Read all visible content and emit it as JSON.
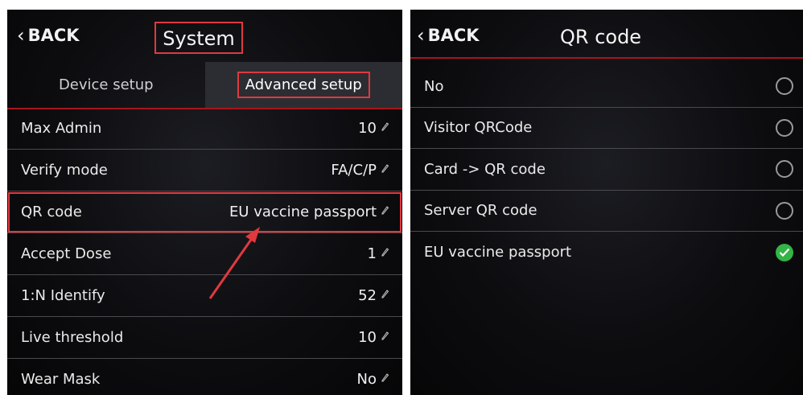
{
  "left": {
    "back_label": "BACK",
    "title": "System",
    "tabs": [
      {
        "label": "Device setup",
        "active": false
      },
      {
        "label": "Advanced setup",
        "active": true
      }
    ],
    "rows": [
      {
        "label": "Max Admin",
        "value": "10"
      },
      {
        "label": "Verify mode",
        "value": "FA/C/P"
      },
      {
        "label": "QR code",
        "value": "EU vaccine passport"
      },
      {
        "label": "Accept Dose",
        "value": "1"
      },
      {
        "label": "1:N Identify",
        "value": "52"
      },
      {
        "label": "Live threshold",
        "value": "10"
      },
      {
        "label": "Wear Mask",
        "value": "No"
      }
    ]
  },
  "right": {
    "back_label": "BACK",
    "title": "QR code",
    "options": [
      {
        "label": "No",
        "selected": false
      },
      {
        "label": "Visitor QRCode",
        "selected": false
      },
      {
        "label": "Card -> QR code",
        "selected": false
      },
      {
        "label": "Server QR code",
        "selected": false
      },
      {
        "label": "EU vaccine passport",
        "selected": true
      }
    ]
  },
  "colors": {
    "accent_red": "#a8151b",
    "highlight_red": "#e0393e",
    "selected_green": "#34b446"
  },
  "icons": {
    "back": "chevron-left-icon",
    "edit": "pencil-icon",
    "radio_unchecked": "radio-empty-icon",
    "radio_checked": "check-circle-icon",
    "annotation": "arrow-icon"
  }
}
